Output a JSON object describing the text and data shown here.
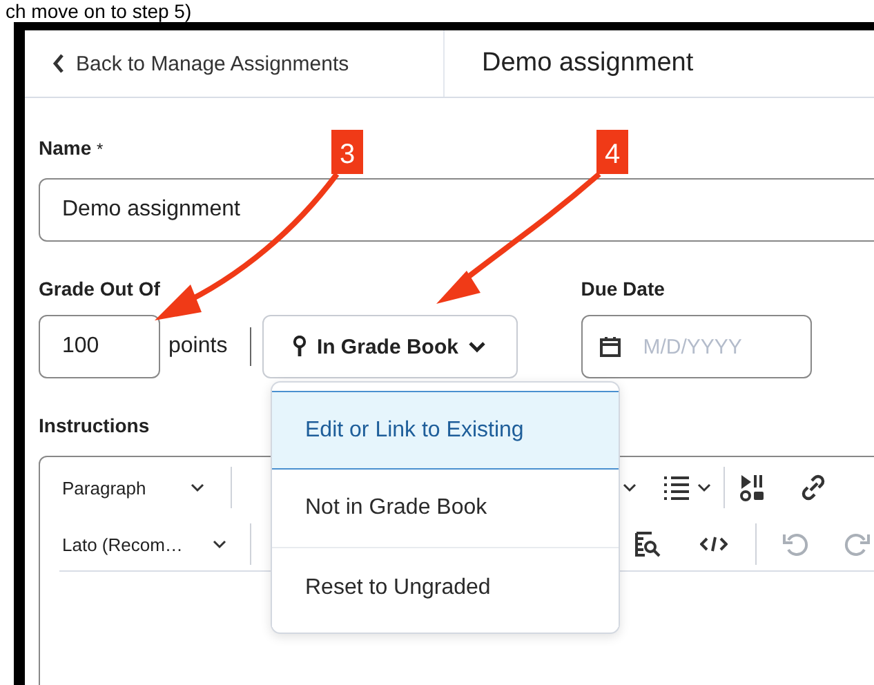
{
  "caption": "ch move on to step 5)",
  "header": {
    "back_link": "Back to Manage Assignments",
    "title": "Demo assignment"
  },
  "name_field": {
    "label": "Name",
    "required_mark": "*",
    "value": "Demo assignment"
  },
  "grade_field": {
    "label": "Grade Out Of",
    "value": "100",
    "unit": "points",
    "grade_book_button": "In Grade Book"
  },
  "due_date": {
    "label": "Due Date",
    "placeholder": "M/D/YYYY"
  },
  "instructions": {
    "label": "Instructions",
    "toolbar_rows": [
      {
        "select": "Paragraph"
      },
      {
        "select": "Lato (Recom…"
      }
    ]
  },
  "grade_book_menu": {
    "items": [
      {
        "label": "Edit or Link to Existing",
        "selected": true
      },
      {
        "label": "Not in Grade Book",
        "selected": false
      },
      {
        "label": "Reset to Ungraded",
        "selected": false
      }
    ]
  },
  "callouts": [
    {
      "label": "3"
    },
    {
      "label": "4"
    }
  ]
}
